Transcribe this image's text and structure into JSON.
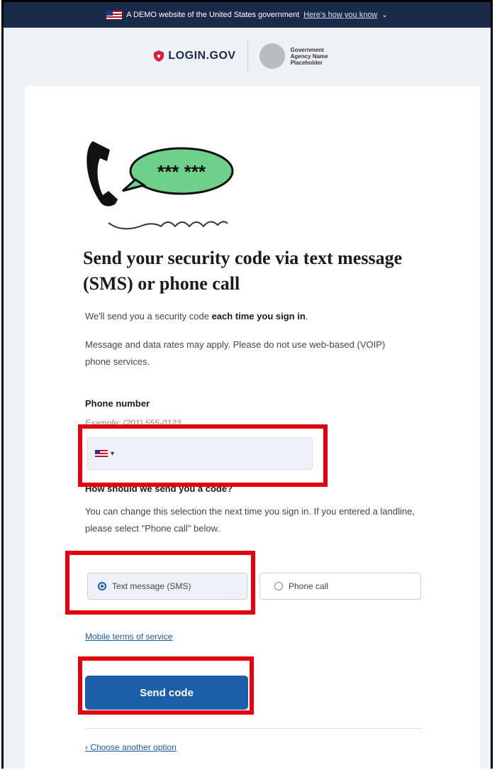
{
  "banner": {
    "text": "A DEMO website of the United States government",
    "link": "Here's how you know"
  },
  "header": {
    "logo_text": "LOGIN.GOV",
    "agency_name": "Government Agency Name Placeholder"
  },
  "illustration": {
    "code_text": "*** ***"
  },
  "page": {
    "title": "Send your security code via text message (SMS) or phone call",
    "intro_prefix": "We'll send you a security code ",
    "intro_bold": "each time you sign in",
    "intro_suffix": ".",
    "rates_note": "Message and data rates may apply. Please do not use web-based (VOIP) phone services."
  },
  "phone": {
    "label": "Phone number",
    "example": "Example: (201) 555-0123",
    "country_selected": "US",
    "value": ""
  },
  "delivery": {
    "label": "How should we send you a code?",
    "hint": "You can change this selection the next time you sign in. If you entered a landline, please select \"Phone call\" below.",
    "options": [
      {
        "label": "Text message (SMS)",
        "selected": true
      },
      {
        "label": "Phone call",
        "selected": false
      }
    ]
  },
  "links": {
    "terms": "Mobile terms of service",
    "choose_another": "‹ Choose another option"
  },
  "buttons": {
    "send_code": "Send code"
  },
  "colors": {
    "banner_bg": "#1a2b4a",
    "primary": "#1b5fa8",
    "highlight": "#e3000f",
    "bubble": "#6fd08c"
  }
}
